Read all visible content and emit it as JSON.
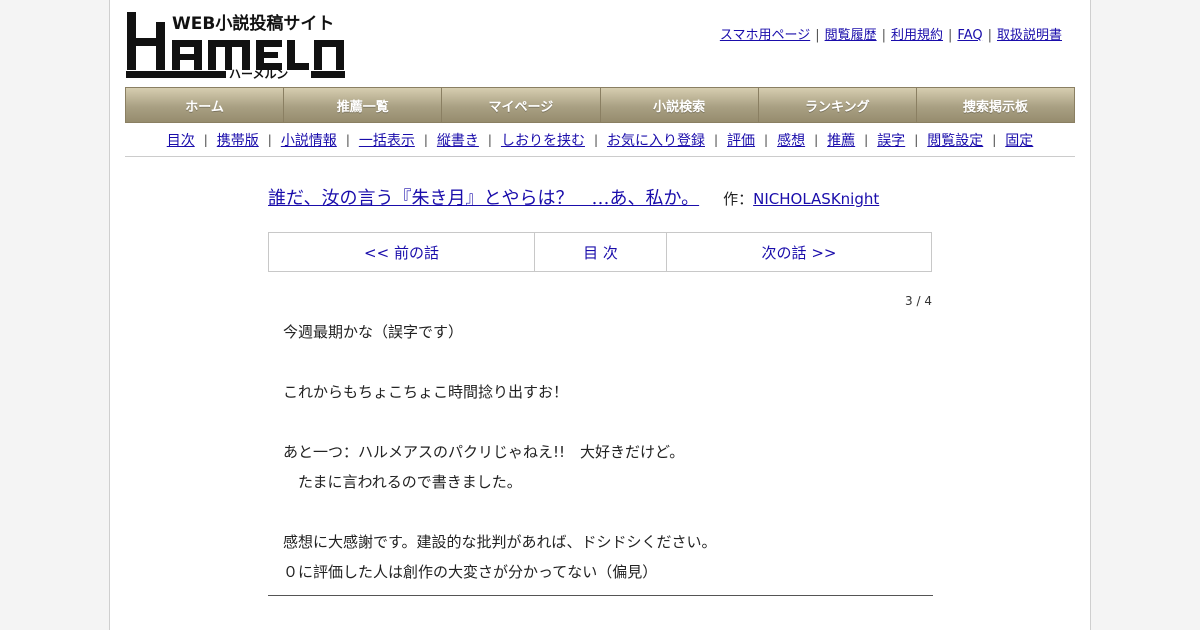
{
  "header": {
    "logo_tagline": "WEB小説投稿サイト",
    "logo_word": "HAMELN",
    "logo_kana": "ハーメルン",
    "top_links": [
      {
        "label": "スマホ用ページ"
      },
      {
        "label": "閲覧履歴"
      },
      {
        "label": "利用規約"
      },
      {
        "label": "FAQ"
      },
      {
        "label": "取扱説明書"
      }
    ]
  },
  "main_nav": [
    {
      "label": "ホーム"
    },
    {
      "label": "推薦一覧"
    },
    {
      "label": "マイページ"
    },
    {
      "label": "小説検索"
    },
    {
      "label": "ランキング"
    },
    {
      "label": "捜索掲示板"
    }
  ],
  "sub_nav": [
    {
      "label": "目次"
    },
    {
      "label": "携帯版"
    },
    {
      "label": "小説情報"
    },
    {
      "label": "一括表示"
    },
    {
      "label": "縦書き"
    },
    {
      "label": "しおりを挟む"
    },
    {
      "label": "お気に入り登録"
    },
    {
      "label": "評価"
    },
    {
      "label": "感想"
    },
    {
      "label": "推薦"
    },
    {
      "label": "誤字"
    },
    {
      "label": "閲覧設定"
    },
    {
      "label": "固定"
    }
  ],
  "novel": {
    "title": "誰だ、汝の言う『朱き月』とやらは？　…あ、私か。",
    "author_prefix": "作：",
    "author": "NICHOLASKnight"
  },
  "episode_nav": {
    "prev": "<< 前の話",
    "toc": "目 次",
    "next": "次の話 >>"
  },
  "page_counter": "3 / 4",
  "body_lines": [
    "今週最期かな（誤字です）",
    "",
    "これからもちょこちょこ時間捻り出すお！",
    "",
    "あと一つ：ハルメアスのパクリじゃねえ!!　大好きだけど。",
    "　たまに言われるので書きました。",
    "",
    "感想に大感謝です。建設的な批判があれば、ドシドシください。",
    "０に評価した人は創作の大変さが分かってない（偏見）"
  ]
}
